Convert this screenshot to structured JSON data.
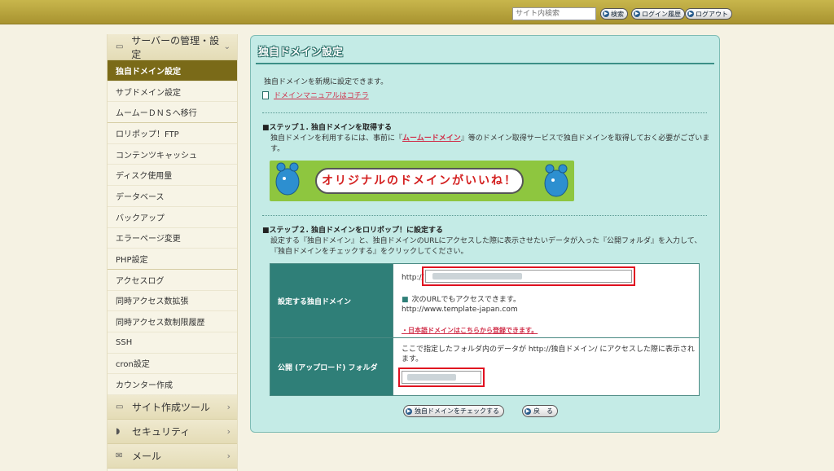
{
  "topbar": {
    "search_placeholder": "サイト内検索",
    "search_button": "検索",
    "login_history_button": "ログイン履歴",
    "logout_button": "ログアウト"
  },
  "sidebar": {
    "section_server": "サーバーの管理・設定",
    "items": [
      {
        "label": "独自ドメイン設定",
        "active": true
      },
      {
        "label": "サブドメイン設定"
      },
      {
        "label": "ムームーＤＮＳへ移行"
      },
      {
        "label": "ロリポップ！FTP"
      },
      {
        "label": "コンテンツキャッシュ"
      },
      {
        "label": "ディスク使用量"
      },
      {
        "label": "データベース"
      },
      {
        "label": "バックアップ"
      },
      {
        "label": "エラーページ変更"
      },
      {
        "label": "PHP設定"
      },
      {
        "label": "アクセスログ"
      },
      {
        "label": "同時アクセス数拡張"
      },
      {
        "label": "同時アクセス数制限履歴"
      },
      {
        "label": "SSH"
      },
      {
        "label": "cron設定"
      },
      {
        "label": "カウンター作成"
      }
    ],
    "section_site_tools": "サイト作成ツール",
    "section_security": "セキュリティ",
    "section_mail": "メール"
  },
  "main": {
    "title": "独自ドメイン設定",
    "intro": "独自ドメインを新規に設定できます。",
    "manual_link": "ドメインマニュアルはコチラ",
    "step1": {
      "heading": "■ステップ１. 独自ドメインを取得する",
      "text_before": "独自ドメインを利用するには、事前に『",
      "link": "ムームードメイン",
      "text_after": "』等のドメイン取得サービスで独自ドメインを取得しておく必要がございます。",
      "banner_text": "オリジナルのドメインがいいね！"
    },
    "step2": {
      "heading": "■ステップ２. 独自ドメインをロリポップ！に設定する",
      "text": "設定する『独自ドメイン』と、独自ドメインのURLにアクセスした際に表示させたいデータが入った『公開フォルダ』を入力して、『独自ドメインをチェックする』をクリックしてください。"
    },
    "form": {
      "domain_label": "設定する独自ドメイン",
      "http_prefix": "http://",
      "www_note": "次のURLでもアクセスできます。",
      "www_url": "http://www.template-japan.com",
      "jp_domain_link": "・日本語ドメインはこちらから登録できます。",
      "folder_label": "公開 (アップロード) フォルダ",
      "folder_text": "ここで指定したフォルダ内のデータが http://独自ドメイン/ にアクセスした際に表示されます。"
    },
    "buttons": {
      "check": "独自ドメインをチェックする",
      "back": "戻　る"
    }
  },
  "colors": {
    "topbar": "#b8a63e",
    "panel_bg": "#c4ebe6",
    "label_bg": "#2f7f78",
    "active_item": "#7a6a18",
    "highlight_frame": "#e01020"
  }
}
